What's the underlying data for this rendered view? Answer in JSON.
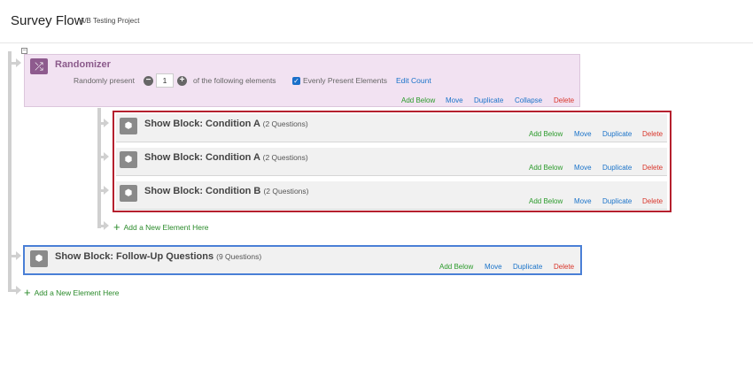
{
  "header": {
    "title": "Survey Flow",
    "subtitle": "A/B Testing Project"
  },
  "randomizer": {
    "title": "Randomizer",
    "prefix": "Randomly present",
    "count": "1",
    "suffix": "of the following elements",
    "evenly_label": "Evenly Present Elements",
    "evenly_checked": true,
    "edit_count": "Edit Count",
    "actions": {
      "add_below": "Add Below",
      "move": "Move",
      "duplicate": "Duplicate",
      "collapse": "Collapse",
      "delete": "Delete"
    }
  },
  "blocks": [
    {
      "title": "Show Block: Condition A",
      "count": "(2 Questions)"
    },
    {
      "title": "Show Block: Condition A",
      "count": "(2 Questions)"
    },
    {
      "title": "Show Block: Condition B",
      "count": "(2 Questions)"
    }
  ],
  "block_actions": {
    "add_below": "Add Below",
    "move": "Move",
    "duplicate": "Duplicate",
    "delete": "Delete"
  },
  "follow_up": {
    "title": "Show Block: Follow-Up Questions",
    "count": "(9 Questions)"
  },
  "add_element": "Add a New Element Here",
  "colors": {
    "randomizer": "#8e5b8e",
    "highlight_red": "#b5202e",
    "highlight_blue": "#4a7fd6",
    "green": "#2a9a2a",
    "blue": "#1a73c9",
    "red": "#d9352a"
  }
}
